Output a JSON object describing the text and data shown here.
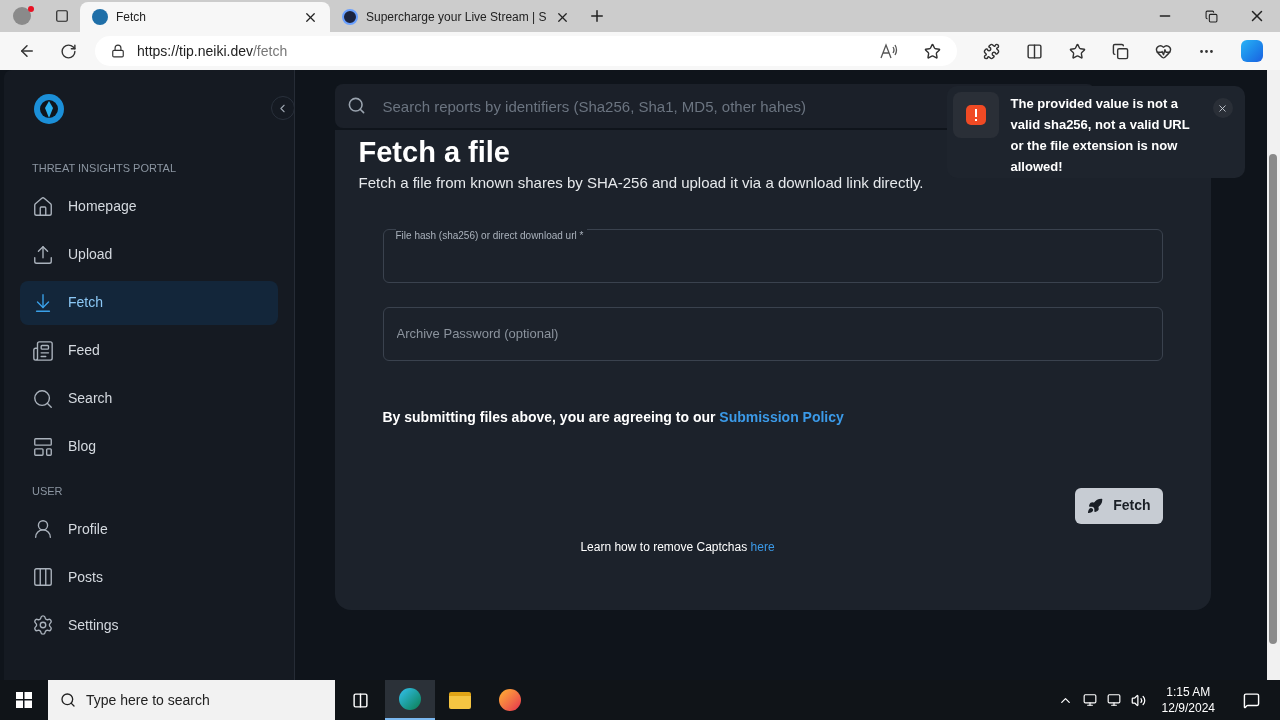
{
  "browser": {
    "tabs": [
      {
        "title": "Fetch",
        "selected": true
      },
      {
        "title": "Supercharge your Live Stream | S",
        "selected": false
      }
    ],
    "url_host": "https://tip.neiki.dev",
    "url_path": "/fetch"
  },
  "sidebar": {
    "sections": [
      {
        "heading": "THREAT INSIGHTS PORTAL",
        "items": [
          {
            "label": "Homepage",
            "kind": "home",
            "selected": false
          },
          {
            "label": "Upload",
            "kind": "upload",
            "selected": false
          },
          {
            "label": "Fetch",
            "kind": "fetch",
            "selected": true
          },
          {
            "label": "Feed",
            "kind": "feed",
            "selected": false
          },
          {
            "label": "Search",
            "kind": "search",
            "selected": false
          },
          {
            "label": "Blog",
            "kind": "blog",
            "selected": false
          }
        ]
      },
      {
        "heading": "USER",
        "items": [
          {
            "label": "Profile",
            "kind": "profile",
            "selected": false
          },
          {
            "label": "Posts",
            "kind": "posts",
            "selected": false
          },
          {
            "label": "Settings",
            "kind": "settings",
            "selected": false
          }
        ]
      }
    ]
  },
  "search": {
    "placeholder": "Search reports by identifiers (Sha256, Sha1, MD5, other hahes)"
  },
  "page": {
    "title": "Fetch a file",
    "subtitle": "Fetch a file from known shares by SHA-256 and upload it via a download link directly.",
    "fields": [
      {
        "label": "File hash (sha256) or direct download url *"
      },
      {
        "placeholder": "Archive Password (optional)"
      }
    ],
    "agreement": "By submitting files above, you are agreeing to our",
    "policy_link": "Submission Policy",
    "button": "Fetch",
    "captcha_text": "Learn how to remove Captchas",
    "captcha_link": "here"
  },
  "toast": {
    "message": "The provided value is not a valid sha256, not a valid URL or the file extension is now allowed!"
  },
  "taskbar": {
    "search_placeholder": "Type here to search",
    "time": "1:15 AM",
    "date": "12/9/2024"
  }
}
